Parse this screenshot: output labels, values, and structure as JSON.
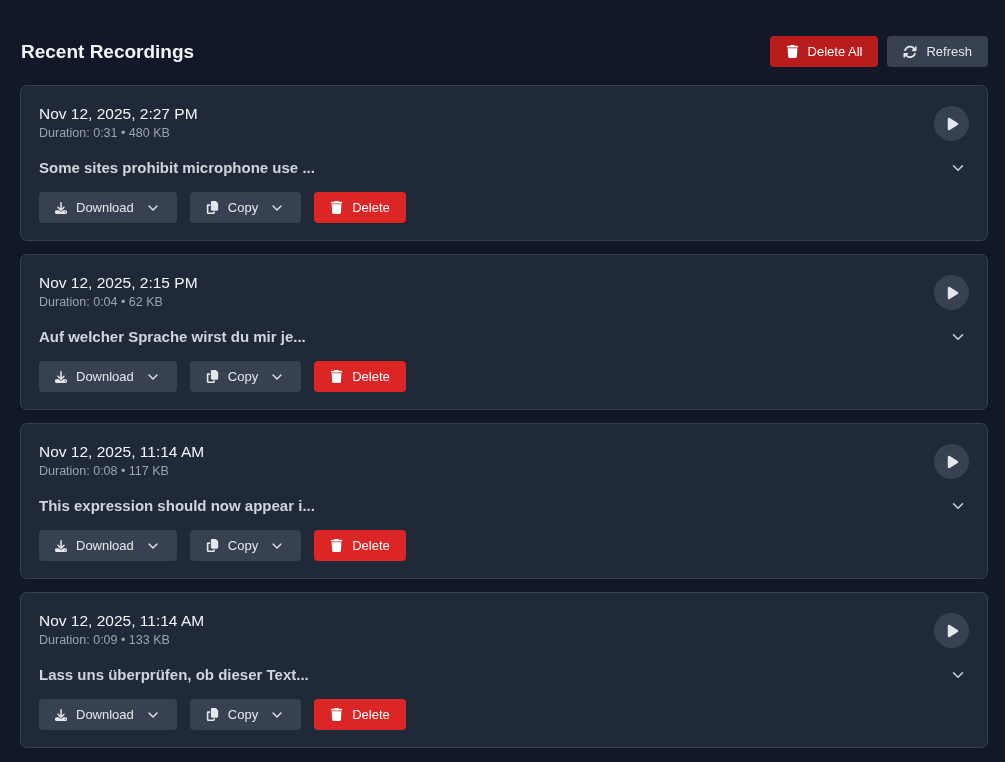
{
  "header": {
    "title": "Recent Recordings",
    "actions": [
      {
        "label": "Delete All",
        "kind": "delete-all"
      },
      {
        "label": "Refresh",
        "kind": "refresh"
      }
    ]
  },
  "recordings": [
    {
      "date": "Nov 12, 2025, 2:27 PM",
      "meta": "Duration: 0:31 • 480 KB",
      "transcript": "Some sites prohibit microphone use ...",
      "expanded": false,
      "actions": [
        {
          "label": "Download",
          "kind": "download",
          "menu": true
        },
        {
          "label": "Copy",
          "kind": "copy",
          "menu": true
        },
        {
          "label": "Delete",
          "kind": "delete",
          "menu": false
        }
      ]
    },
    {
      "date": "Nov 12, 2025, 2:15 PM",
      "meta": "Duration: 0:04 • 62 KB",
      "transcript": "Auf welcher Sprache wirst du mir je...",
      "expanded": false,
      "actions": [
        {
          "label": "Download",
          "kind": "download",
          "menu": true
        },
        {
          "label": "Copy",
          "kind": "copy",
          "menu": true
        },
        {
          "label": "Delete",
          "kind": "delete",
          "menu": false
        }
      ]
    },
    {
      "date": "Nov 12, 2025, 11:14 AM",
      "meta": "Duration: 0:08 • 117 KB",
      "transcript": "This expression should now appear i...",
      "expanded": false,
      "actions": [
        {
          "label": "Download",
          "kind": "download",
          "menu": true
        },
        {
          "label": "Copy",
          "kind": "copy",
          "menu": true
        },
        {
          "label": "Delete",
          "kind": "delete",
          "menu": false
        }
      ]
    },
    {
      "date": "Nov 12, 2025, 11:14 AM",
      "meta": "Duration: 0:09 • 133 KB",
      "transcript": "Lass uns überprüfen, ob dieser Text...",
      "expanded": false,
      "actions": [
        {
          "label": "Download",
          "kind": "download",
          "menu": true
        },
        {
          "label": "Copy",
          "kind": "copy",
          "menu": true
        },
        {
          "label": "Delete",
          "kind": "delete",
          "menu": false
        }
      ]
    }
  ]
}
